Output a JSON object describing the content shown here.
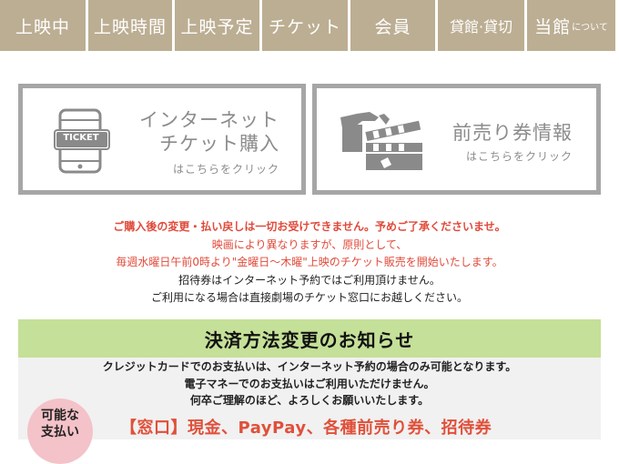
{
  "nav": {
    "items": [
      {
        "label": "上映中",
        "suffix": ""
      },
      {
        "label": "上映時間",
        "suffix": ""
      },
      {
        "label": "上映予定",
        "suffix": ""
      },
      {
        "label": "チケット",
        "suffix": ""
      },
      {
        "label": "会員",
        "suffix": ""
      },
      {
        "label": "貸館·貸切",
        "suffix": ""
      },
      {
        "label": "当館",
        "suffix": "について"
      }
    ]
  },
  "banners": {
    "ticket": {
      "line1": "インターネット",
      "line2": "チケット購入",
      "sub": "はこちらをクリック",
      "icon_text": "TICKET"
    },
    "advance": {
      "line1": "前売り券情報",
      "sub": "はこちらをクリック"
    }
  },
  "notices": {
    "line1": "ご購入後の変更・払い戻しは一切お受けできません。予めご了承くださいませ。",
    "line2": "映画により異なりますが、原則として、",
    "line3": "毎週水曜日午前0時より\"金曜日～木曜\"上映のチケット販売を開始いたします。",
    "line4": "招待券はインターネット予約ではご利用頂けません。",
    "line5": "ご利用になる場合は直接劇場のチケット窓口にお越しください。"
  },
  "payment": {
    "title": "決済方法変更のお知らせ",
    "line1": "クレジットカードでのお支払いは、インターネット予約の場合のみ可能となります。",
    "line2": "電子マネーでのお支払いはご利用いただけません。",
    "line3": "何卒ご理解のほど、よろしくお願いいたします。",
    "badge_line1": "可能な",
    "badge_line2": "支払い",
    "window_methods": "【窓口】現金、PayPay、各種前売り券、招待券"
  },
  "colors": {
    "nav_bg": "#bcae93",
    "accent_red": "#e04a3a",
    "header_green": "#c5e098",
    "badge_pink": "#f4c2c9"
  }
}
